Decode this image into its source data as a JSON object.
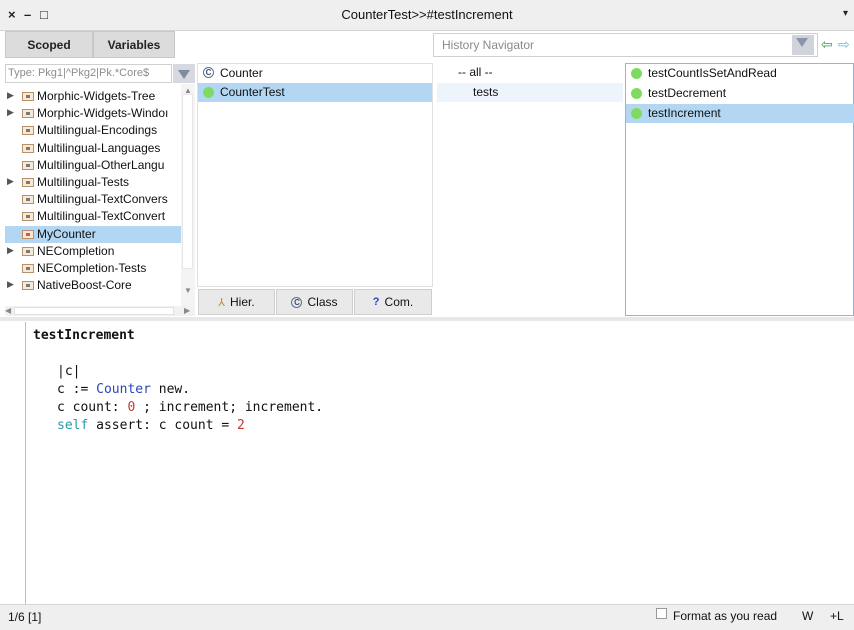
{
  "window": {
    "title": "CounterTest>>#testIncrement",
    "close": "×",
    "minimize": "–",
    "maximize": "□",
    "menu": "▾"
  },
  "toolbar": {
    "scoped": "Scoped",
    "variables": "Variables",
    "history_placeholder": "History Navigator",
    "back": "⇦",
    "forward": "⇨"
  },
  "packages": {
    "filter_placeholder": "Type: Pkg1|^Pkg2|Pk.*Core$",
    "items": [
      {
        "label": "Morphic-Widgets-Tree",
        "expandable": true
      },
      {
        "label": "Morphic-Widgets-Windoı",
        "expandable": true
      },
      {
        "label": "Multilingual-Encodings",
        "expandable": false
      },
      {
        "label": "Multilingual-Languages",
        "expandable": false
      },
      {
        "label": "Multilingual-OtherLangu",
        "expandable": false
      },
      {
        "label": "Multilingual-Tests",
        "expandable": true
      },
      {
        "label": "Multilingual-TextConvers",
        "expandable": false
      },
      {
        "label": "Multilingual-TextConvert",
        "expandable": false
      },
      {
        "label": "MyCounter",
        "expandable": false,
        "selected": true
      },
      {
        "label": "NECompletion",
        "expandable": true
      },
      {
        "label": "NECompletion-Tests",
        "expandable": false
      },
      {
        "label": "NativeBoost-Core",
        "expandable": true
      }
    ]
  },
  "classes": {
    "items": [
      {
        "label": "Counter",
        "icon": "C",
        "selected": false
      },
      {
        "label": "CounterTest",
        "icon": "green-dot",
        "selected": true
      }
    ],
    "buttons": {
      "hier": "Hier.",
      "class": "Class",
      "com": "Com."
    }
  },
  "protocols": {
    "items": [
      {
        "label": "-- all --",
        "selected": false
      },
      {
        "label": "tests",
        "selected": true
      }
    ]
  },
  "methods": {
    "items": [
      {
        "label": "testCountIsSetAndRead",
        "selected": false
      },
      {
        "label": "testDecrement",
        "selected": false
      },
      {
        "label": "testIncrement",
        "selected": true
      }
    ]
  },
  "code": {
    "method_name": "testIncrement",
    "temps": "|c|",
    "line2": {
      "a": "c := ",
      "b": "Counter",
      "c": " new."
    },
    "line3": {
      "a": "c count: ",
      "b": "0",
      "c": " ; increment; increment."
    },
    "line4": {
      "a": "self",
      "b": " assert: c count = ",
      "c": "2"
    }
  },
  "status": {
    "position": "1/6 [1]",
    "format_label": "Format as you read",
    "w": "W",
    "l": "+L"
  },
  "colors": {
    "selection": "#b3d7f3",
    "green_dot": "#7edb62",
    "keyword_self": "#2a9aa3",
    "class_ref": "#2b47b8",
    "number": "#c33a3a"
  }
}
